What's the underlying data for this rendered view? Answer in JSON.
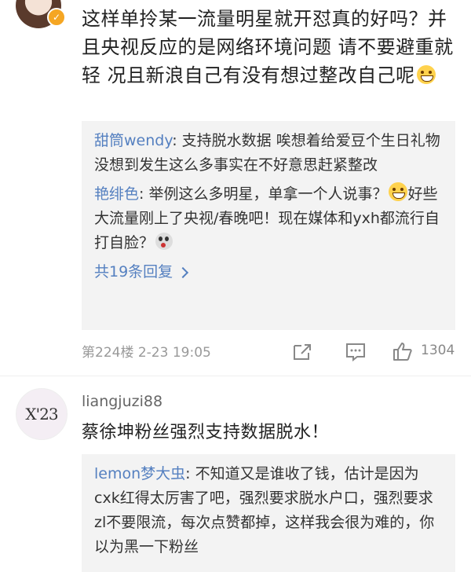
{
  "post1": {
    "text": "这样单拎某一流量明星就开怼真的好吗？并且央视反应的是网络环境问题 请不要避重就轻 况且新浪自己有没有想过整改自己呢",
    "replies": [
      {
        "user": "甜筒wendy",
        "text": "支持脱水数据 唉想着给爱豆个生日礼物没想到发生这么多事实在不好意思赶紧整改"
      },
      {
        "user": "艳绯色",
        "text_a": "举例这么多明星，单拿一个人说事？",
        "text_b": "好些大流量刚上了央视/春晚吧！现在媒体和yxh都流行自打自脸？"
      }
    ],
    "more_replies": "共19条回复",
    "floor_time": "第224楼  2-23 19:05",
    "like_count": "1304"
  },
  "post2": {
    "username": "liangjuzi88",
    "avatar_text": "X'23",
    "text": "蔡徐坤粉丝强烈支持数据脱水！",
    "reply": {
      "user": "lemon梦大虫",
      "text": "不知道又是谁收了钱，估计是因为cxk红得太厉害了吧，强烈要求脱水户口，强烈要求zl不要限流，每次点赞都掉，这样我会很为难的，你以为黑一下粉丝"
    }
  },
  "colors": {
    "link": "#5580c0",
    "reply_bg": "#f3f3f3",
    "badge": "#f5a623"
  }
}
